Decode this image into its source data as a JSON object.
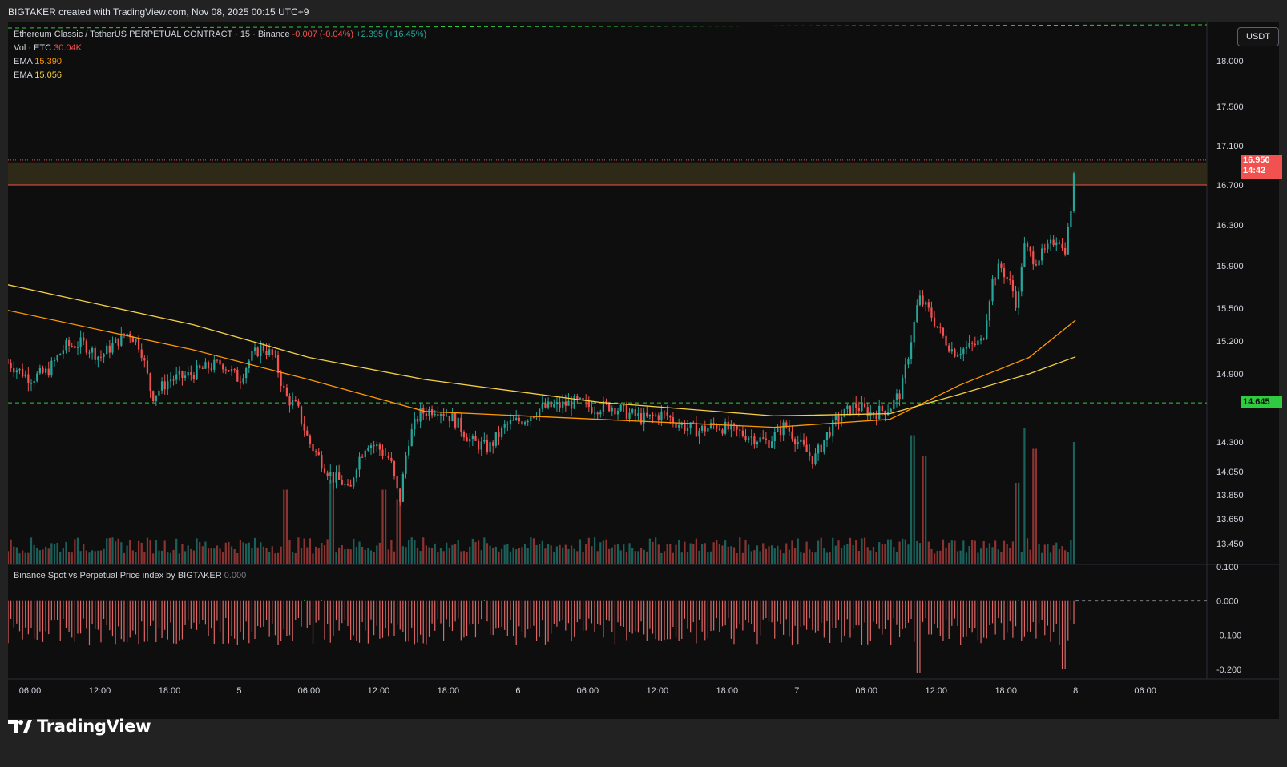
{
  "header": {
    "attribution": "BIGTAKER created with TradingView.com, Nov 08, 2025 00:15 UTC+9"
  },
  "legend": {
    "symbol_line": "Ethereum Classic / TetherUS PERPETUAL CONTRACT · 15 · Binance",
    "change": "-0.007 (-0.04%)",
    "change_color": "#f2524f",
    "range": "+2.395 (+16.45%)",
    "range_color": "#26a69a",
    "volume_label": "Vol · ETC",
    "volume_value": "30.04K",
    "ema1_label": "EMA",
    "ema1_value": "15.390",
    "ema1_color": "#ff9800",
    "ema2_label": "EMA",
    "ema2_value": "15.056",
    "ema2_color": "#f5d142"
  },
  "sub_pane": {
    "title": "Binance Spot vs Perpetual Price index by BIGTAKER",
    "value": "0.000"
  },
  "price_scale": {
    "unit": "USDT",
    "current_price": "16.950",
    "countdown": "14:42",
    "level_price": "14.645"
  },
  "brand": {
    "name": "TradingView"
  },
  "colors": {
    "up": "#26a69a",
    "down": "#f2524f",
    "background": "#0e0e0e",
    "zone_fill": "#2e2a17",
    "zone_line": "#f2524f",
    "dashed_level": "#2fcc40"
  },
  "chart_data": [
    {
      "type": "candlestick",
      "interval": "15",
      "y_ticks": [
        "18.000",
        "17.500",
        "17.100",
        "16.700",
        "16.300",
        "15.900",
        "15.500",
        "15.200",
        "14.900",
        "14.300",
        "14.050",
        "13.850",
        "13.650",
        "13.450"
      ],
      "ylim": [
        13.3,
        18.28
      ],
      "x_ticks": [
        "06:00",
        "12:00",
        "18:00",
        "5",
        "06:00",
        "12:00",
        "18:00",
        "6",
        "06:00",
        "12:00",
        "18:00",
        "7",
        "06:00",
        "12:00",
        "18:00",
        "8",
        "06:00"
      ],
      "x_tick_hours": [
        6,
        12,
        18,
        24,
        30,
        36,
        42,
        48,
        54,
        60,
        66,
        72,
        78,
        84,
        90,
        96,
        102
      ],
      "x_range_hours": [
        4.1,
        107.3
      ],
      "last_bar_hour": 96.0,
      "price_path": [
        [
          4.1,
          15.0
        ],
        [
          6.0,
          14.86
        ],
        [
          7.5,
          14.92
        ],
        [
          9.0,
          15.15
        ],
        [
          10.5,
          15.18
        ],
        [
          12.0,
          15.05
        ],
        [
          13.5,
          15.2
        ],
        [
          14.5,
          15.28
        ],
        [
          15.5,
          15.15
        ],
        [
          16.5,
          14.7
        ],
        [
          18.0,
          14.85
        ],
        [
          19.5,
          14.88
        ],
        [
          21.0,
          14.95
        ],
        [
          22.5,
          15.0
        ],
        [
          24.0,
          14.85
        ],
        [
          25.0,
          15.05
        ],
        [
          26.0,
          15.15
        ],
        [
          27.0,
          15.05
        ],
        [
          28.0,
          14.7
        ],
        [
          29.0,
          14.6
        ],
        [
          30.0,
          14.3
        ],
        [
          31.0,
          14.15
        ],
        [
          32.0,
          14.0
        ],
        [
          33.0,
          13.95
        ],
        [
          33.5,
          13.85
        ],
        [
          34.0,
          14.1
        ],
        [
          35.0,
          14.3
        ],
        [
          36.0,
          14.25
        ],
        [
          37.0,
          14.15
        ],
        [
          37.8,
          13.78
        ],
        [
          38.5,
          14.3
        ],
        [
          39.5,
          14.55
        ],
        [
          41.0,
          14.6
        ],
        [
          42.5,
          14.5
        ],
        [
          44.0,
          14.3
        ],
        [
          45.5,
          14.25
        ],
        [
          47.0,
          14.45
        ],
        [
          48.5,
          14.5
        ],
        [
          50.0,
          14.6
        ],
        [
          51.5,
          14.62
        ],
        [
          53.0,
          14.65
        ],
        [
          54.5,
          14.6
        ],
        [
          56.0,
          14.62
        ],
        [
          57.5,
          14.55
        ],
        [
          59.0,
          14.5
        ],
        [
          60.5,
          14.55
        ],
        [
          62.0,
          14.45
        ],
        [
          63.5,
          14.4
        ],
        [
          65.0,
          14.45
        ],
        [
          66.5,
          14.4
        ],
        [
          68.0,
          14.35
        ],
        [
          69.5,
          14.3
        ],
        [
          71.0,
          14.45
        ],
        [
          72.5,
          14.25
        ],
        [
          73.5,
          14.15
        ],
        [
          74.5,
          14.35
        ],
        [
          75.5,
          14.5
        ],
        [
          77.0,
          14.62
        ],
        [
          78.5,
          14.55
        ],
        [
          80.0,
          14.6
        ],
        [
          81.0,
          14.75
        ],
        [
          82.0,
          15.3
        ],
        [
          82.5,
          15.6
        ],
        [
          83.5,
          15.45
        ],
        [
          84.5,
          15.25
        ],
        [
          85.5,
          15.1
        ],
        [
          87.0,
          15.15
        ],
        [
          88.0,
          15.2
        ],
        [
          88.8,
          15.75
        ],
        [
          89.5,
          15.9
        ],
        [
          90.5,
          15.7
        ],
        [
          91.0,
          15.5
        ],
        [
          91.5,
          16.1
        ],
        [
          92.5,
          15.95
        ],
        [
          93.5,
          16.05
        ],
        [
          94.5,
          16.2
        ],
        [
          95.0,
          16.0
        ],
        [
          95.5,
          16.35
        ],
        [
          96.0,
          16.95
        ]
      ],
      "ema_fast_path": [
        [
          4.1,
          15.48
        ],
        [
          20,
          15.12
        ],
        [
          30,
          14.85
        ],
        [
          40,
          14.57
        ],
        [
          55,
          14.5
        ],
        [
          70,
          14.43
        ],
        [
          80,
          14.5
        ],
        [
          86,
          14.8
        ],
        [
          92,
          15.05
        ],
        [
          96,
          15.39
        ]
      ],
      "ema_slow_path": [
        [
          4.1,
          15.72
        ],
        [
          20,
          15.35
        ],
        [
          30,
          15.05
        ],
        [
          40,
          14.85
        ],
        [
          55,
          14.65
        ],
        [
          70,
          14.53
        ],
        [
          80,
          14.55
        ],
        [
          86,
          14.72
        ],
        [
          92,
          14.9
        ],
        [
          96,
          15.056
        ]
      ],
      "resistance_zone": [
        16.7,
        16.93
      ],
      "support_level": 14.645,
      "top_dashed_level": 18.4,
      "volume": {
        "last_value": "30.04K",
        "spikes": [
          [
            28.0,
            0.55
          ],
          [
            32.0,
            0.62
          ],
          [
            36.5,
            0.55
          ],
          [
            37.8,
            0.48
          ],
          [
            82.0,
            0.95
          ],
          [
            83.0,
            0.8
          ],
          [
            91.0,
            0.6
          ],
          [
            91.6,
            1.0
          ],
          [
            92.5,
            0.85
          ],
          [
            96.0,
            0.9
          ]
        ]
      }
    },
    {
      "type": "bar",
      "title": "Binance Spot vs Perpetual Price index by BIGTAKER",
      "y_ticks": [
        "0.100",
        "0.000",
        "-0.100",
        "-0.200"
      ],
      "ylim": [
        -0.235,
        0.1
      ],
      "current_value": "0.000",
      "typical_range": [
        -0.05,
        -0.16
      ],
      "troughs": [
        [
          82.5,
          -0.21
        ],
        [
          95.0,
          -0.2
        ]
      ],
      "positive_bars_hours": [
        29.5,
        31.0,
        45.0,
        91.0
      ]
    }
  ]
}
